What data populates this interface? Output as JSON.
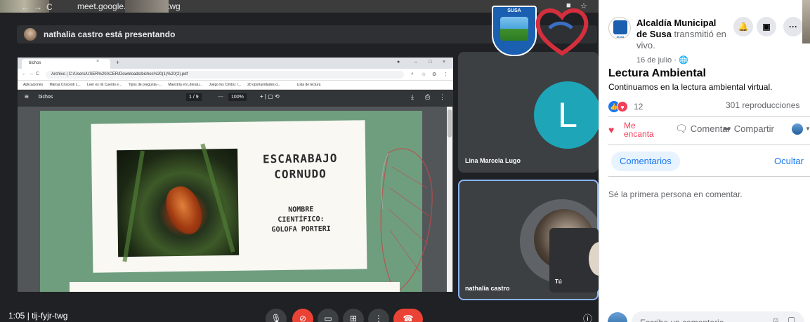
{
  "browser": {
    "url": "meet.google.com/tij-fyjr-twg"
  },
  "meet": {
    "presenting_text": "nathalia castro está presentando",
    "meeting_code": "tij-fyjr-twg",
    "time": "1:05",
    "participants": [
      {
        "name": "Lina Marcela Lugo",
        "initial": "L",
        "avatar_color": "#1ea6b8"
      },
      {
        "name": "nathalia castro"
      },
      {
        "name": "Tú"
      }
    ]
  },
  "shared_screen": {
    "tab_label": "bichos",
    "address": "Archivo | C:/Users/USER%20ACER/Downloads/bichos%20(1)%20(2).pdf",
    "bookmarks": [
      "Aplicaciones",
      "Marisa Criscenti L...",
      "Leer es mi Cuento e...",
      "Tipos de pregunta -...",
      "Maestría en Literatu...",
      "Juego los Cimbo: l...",
      "20 oportunidades d...",
      "Lista de lectura"
    ],
    "pdf_name": "bichos",
    "page_indicator": "1 / 9",
    "zoom": "100%",
    "slide": {
      "title": "ESCARABAJO CORNUDO",
      "subtitle": "NOMBRE CIENTÍFICO: GOLOFA PORTERI"
    }
  },
  "facebook": {
    "page_name": "Alcaldía Municipal de Susa",
    "action": "transmitió en vivo.",
    "date": "16 de julio ·",
    "video_title": "Lectura Ambiental",
    "description": "Continuamos en la lectura ambiental virtual.",
    "reaction_count": "12",
    "views": "301 reproducciones",
    "actions": {
      "love": "Me encanta",
      "comment": "Comentar",
      "share": "Compartir"
    },
    "comments_tab": "Comentarios",
    "hide": "Ocultar",
    "empty_state": "Sé la primera persona en comentar.",
    "comment_placeholder": "Escribe un comentario..."
  },
  "logo": {
    "text": "SUSA"
  },
  "colors": {
    "meet_bg": "#202124",
    "fb_blue": "#1877f2",
    "hangup_red": "#ea4335",
    "love_red": "#f33e58"
  }
}
